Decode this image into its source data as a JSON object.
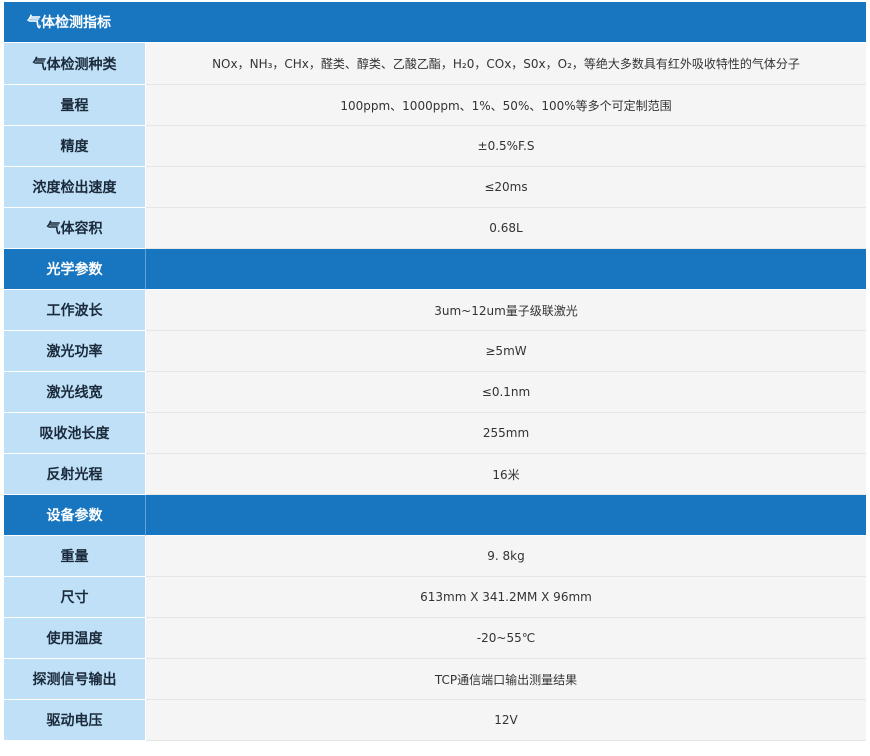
{
  "sections": [
    {
      "title": "气体检测指标",
      "rows": [
        {
          "label": "气体检测种类",
          "value": "NOx，NH₃，CHx，醛类、醇类、乙酸乙酯，H₂0，COx，S0x，O₂，等绝大多数具有红外吸收特性的气体分子"
        },
        {
          "label": "量程",
          "value": "100ppm、1000ppm、1%、50%、100%等多个可定制范围"
        },
        {
          "label": "精度",
          "value": "±0.5%F.S"
        },
        {
          "label": "浓度检出速度",
          "value": "≤20ms"
        },
        {
          "label": "气体容积",
          "value": "0.68L"
        }
      ]
    },
    {
      "title": "光学参数",
      "rows": [
        {
          "label": "工作波长",
          "value": "3um~12um量子级联激光"
        },
        {
          "label": "激光功率",
          "value": "≥5mW"
        },
        {
          "label": "激光线宽",
          "value": "≤0.1nm"
        },
        {
          "label": "吸收池长度",
          "value": "255mm"
        },
        {
          "label": "反射光程",
          "value": "16米"
        }
      ]
    },
    {
      "title": "设备参数",
      "rows": [
        {
          "label": "重量",
          "value": "9. 8kg"
        },
        {
          "label": "尺寸",
          "value": "613mm X 341.2MM X 96mm"
        },
        {
          "label": "使用温度",
          "value": "-20~55℃"
        },
        {
          "label": "探测信号输出",
          "value": "TCP通信端口输出测量结果"
        },
        {
          "label": "驱动电压",
          "value": "12V"
        }
      ]
    }
  ],
  "colors": {
    "section_bg": "#1876c0",
    "label_bg": "#bfe0f7",
    "value_bg": "#f5f5f5"
  }
}
